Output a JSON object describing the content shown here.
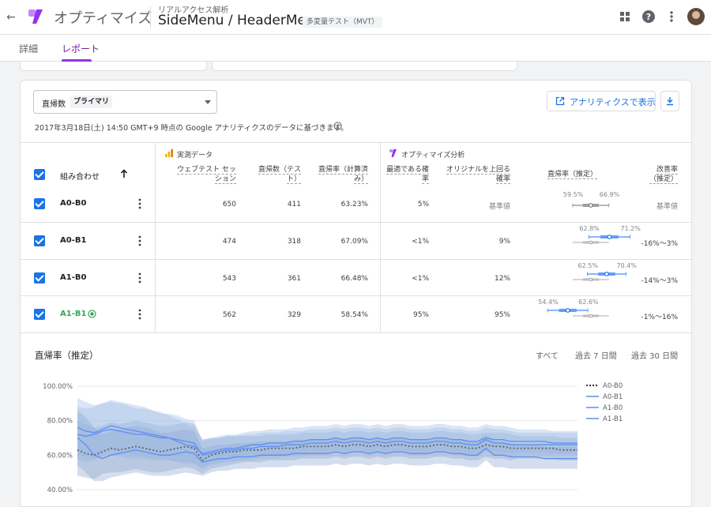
{
  "header": {
    "app_name": "オプティマイズ",
    "container": "リアルアクセス解析",
    "experiment_title": "SideMenu / HeaderMenu",
    "experiment_type": "多変量テスト（MVT）"
  },
  "tabs": [
    {
      "label": "詳細",
      "active": false
    },
    {
      "label": "レポート",
      "active": true
    }
  ],
  "report": {
    "metric_label": "直帰数",
    "metric_value": "プライマリ",
    "analytics_button": "アナリティクスで表示",
    "data_note": "2017年3月18日(土) 14:50 GMT+9 時点の Google アナリティクスのデータに基づきます。"
  },
  "table": {
    "group_observed": "実測データ",
    "group_optimize": "オプティマイズ分析",
    "col_combo": "組み合わせ",
    "col_sessions": "ウェブテスト セッ\nション",
    "col_bounces": "直帰数（テス\nト）",
    "col_rate": "直帰率（計算済\nみ）",
    "col_best": "最適である確\n率",
    "col_beat": "オリジナルを上回る\n確率",
    "col_ci": "直帰率（推定）",
    "col_improve": "改善率\n（推定）",
    "rows": [
      {
        "name": "A0-B0",
        "sessions": "650",
        "bounces": "411",
        "rate": "63.23%",
        "best": "5%",
        "beat": "基準値",
        "ci_low": 59.5,
        "ci_high": 66.9,
        "ci_low_label": "59.5%",
        "ci_high_label": "66.9%",
        "improve": "基準値",
        "winner": false
      },
      {
        "name": "A0-B1",
        "sessions": "474",
        "bounces": "318",
        "rate": "67.09%",
        "best": "<1%",
        "beat": "9%",
        "ci_low": 62.8,
        "ci_high": 71.2,
        "ci_low_label": "62.8%",
        "ci_high_label": "71.2%",
        "improve": "-16%〜3%",
        "winner": false
      },
      {
        "name": "A1-B0",
        "sessions": "543",
        "bounces": "361",
        "rate": "66.48%",
        "best": "<1%",
        "beat": "12%",
        "ci_low": 62.5,
        "ci_high": 70.4,
        "ci_low_label": "62.5%",
        "ci_high_label": "70.4%",
        "improve": "-14%〜3%",
        "winner": false
      },
      {
        "name": "A1-B1",
        "sessions": "562",
        "bounces": "329",
        "rate": "58.54%",
        "best": "95%",
        "beat": "95%",
        "ci_low": 54.4,
        "ci_high": 62.6,
        "ci_low_label": "54.4%",
        "ci_high_label": "62.6%",
        "improve": "-1%〜16%",
        "winner": true
      }
    ]
  },
  "chart_section": {
    "title": "直帰率（推定）",
    "ranges": [
      "すべて",
      "過去 7 日間",
      "過去 30 日間"
    ]
  },
  "colors": {
    "accent_blue": "#1a73e8",
    "series_blue": "#669df6",
    "band_blue": "#a6c0ea",
    "winner_green": "#34a853",
    "optimize_purple": "#9334e6"
  },
  "chart_data": {
    "type": "line",
    "ylim": [
      40,
      100
    ],
    "yticks": [
      "100.00%",
      "80.00%",
      "60.00%",
      "40.00%"
    ],
    "grid": true,
    "legend_position": "right",
    "x": [
      0,
      1,
      2,
      3,
      4,
      5,
      6,
      7,
      8,
      9,
      10,
      11,
      12,
      13,
      14,
      15,
      16,
      17,
      18,
      19,
      20,
      21,
      22,
      23,
      24,
      25,
      26,
      27,
      28,
      29,
      30,
      31,
      32,
      33,
      34,
      35,
      36,
      37,
      38,
      39,
      40,
      41,
      42,
      43,
      44,
      45,
      46,
      47,
      48,
      49,
      50,
      51,
      52,
      53,
      54,
      55,
      56,
      57,
      58,
      59,
      60
    ],
    "series": [
      {
        "name": "A0-B0",
        "style": "dotted",
        "values": [
          63,
          61,
          60,
          62,
          64,
          63,
          64,
          65,
          64,
          63,
          62,
          63,
          64,
          65,
          64,
          57,
          60,
          61,
          62,
          62,
          63,
          63,
          63,
          64,
          64,
          64,
          64,
          65,
          65,
          65,
          65,
          66,
          65,
          66,
          66,
          65,
          66,
          65,
          66,
          66,
          65,
          65,
          65,
          66,
          66,
          65,
          65,
          64,
          64,
          66,
          65,
          65,
          64,
          64,
          64,
          64,
          64,
          64,
          63,
          63,
          63
        ],
        "band_low": [
          48,
          47,
          46,
          49,
          50,
          50,
          51,
          52,
          51,
          50,
          50,
          51,
          52,
          53,
          52,
          49,
          52,
          53,
          54,
          55,
          56,
          56,
          56,
          57,
          57,
          57,
          57,
          58,
          58,
          58,
          58,
          59,
          58,
          59,
          59,
          58,
          59,
          58,
          59,
          59,
          58,
          58,
          58,
          59,
          59,
          58,
          58,
          57,
          57,
          59,
          58,
          58,
          57,
          58,
          58,
          58,
          58,
          58,
          57,
          57,
          57
        ],
        "band_high": [
          80,
          78,
          76,
          77,
          79,
          78,
          79,
          80,
          79,
          78,
          77,
          77,
          78,
          79,
          78,
          69,
          70,
          70,
          71,
          71,
          71,
          71,
          71,
          72,
          72,
          72,
          72,
          73,
          73,
          73,
          73,
          74,
          73,
          74,
          74,
          73,
          74,
          73,
          74,
          74,
          73,
          73,
          73,
          74,
          74,
          73,
          73,
          72,
          72,
          73,
          73,
          73,
          72,
          71,
          71,
          71,
          71,
          71,
          70,
          70,
          70
        ]
      },
      {
        "name": "A0-B1",
        "style": "solid",
        "values": [
          76,
          74,
          73,
          75,
          77,
          76,
          75,
          74,
          73,
          72,
          71,
          70,
          68,
          66,
          65,
          61,
          62,
          63,
          64,
          64,
          65,
          66,
          66,
          67,
          67,
          67,
          68,
          68,
          69,
          69,
          69,
          70,
          69,
          70,
          70,
          69,
          70,
          69,
          70,
          70,
          69,
          69,
          69,
          70,
          70,
          69,
          69,
          68,
          68,
          70,
          69,
          69,
          68,
          68,
          68,
          68,
          68,
          67,
          67,
          67,
          67
        ],
        "band_low": [
          60,
          59,
          58,
          60,
          62,
          61,
          61,
          60,
          59,
          58,
          58,
          57,
          56,
          55,
          55,
          53,
          55,
          56,
          57,
          57,
          58,
          59,
          59,
          60,
          60,
          60,
          61,
          61,
          62,
          62,
          62,
          63,
          62,
          63,
          63,
          62,
          63,
          62,
          63,
          63,
          62,
          62,
          62,
          63,
          63,
          62,
          62,
          61,
          61,
          63,
          62,
          62,
          61,
          62,
          62,
          62,
          62,
          61,
          61,
          61,
          61
        ],
        "band_high": [
          93,
          91,
          89,
          90,
          92,
          91,
          90,
          89,
          88,
          86,
          85,
          83,
          81,
          78,
          76,
          69,
          70,
          71,
          72,
          72,
          73,
          74,
          74,
          75,
          75,
          75,
          76,
          76,
          77,
          77,
          77,
          78,
          77,
          78,
          78,
          77,
          78,
          77,
          78,
          78,
          77,
          77,
          77,
          78,
          78,
          77,
          77,
          76,
          76,
          78,
          77,
          77,
          76,
          75,
          75,
          75,
          75,
          74,
          74,
          74,
          74
        ]
      },
      {
        "name": "A1-B0",
        "style": "solid",
        "values": [
          72,
          71,
          72,
          74,
          75,
          74,
          73,
          72,
          72,
          71,
          70,
          70,
          69,
          68,
          67,
          60,
          61,
          62,
          63,
          63,
          64,
          64,
          65,
          65,
          65,
          66,
          66,
          66,
          67,
          67,
          67,
          68,
          67,
          68,
          68,
          67,
          68,
          67,
          68,
          68,
          67,
          67,
          67,
          68,
          68,
          67,
          67,
          66,
          66,
          69,
          67,
          67,
          66,
          66,
          66,
          66,
          66,
          66,
          66,
          66,
          66
        ],
        "band_low": [
          57,
          56,
          57,
          59,
          60,
          59,
          58,
          58,
          58,
          57,
          57,
          57,
          56,
          56,
          55,
          52,
          54,
          55,
          56,
          56,
          57,
          57,
          58,
          58,
          58,
          59,
          59,
          59,
          60,
          60,
          60,
          61,
          60,
          61,
          61,
          60,
          61,
          60,
          61,
          61,
          60,
          60,
          60,
          61,
          61,
          60,
          60,
          59,
          59,
          62,
          60,
          60,
          59,
          60,
          60,
          60,
          60,
          60,
          60,
          60,
          60
        ],
        "band_high": [
          88,
          87,
          88,
          90,
          91,
          90,
          89,
          87,
          87,
          86,
          84,
          84,
          83,
          81,
          80,
          68,
          69,
          70,
          71,
          71,
          72,
          72,
          73,
          73,
          73,
          74,
          74,
          74,
          75,
          75,
          75,
          76,
          75,
          76,
          76,
          75,
          76,
          75,
          76,
          76,
          75,
          75,
          75,
          76,
          76,
          75,
          75,
          74,
          74,
          76,
          75,
          75,
          74,
          73,
          73,
          73,
          73,
          73,
          73,
          73,
          73
        ]
      },
      {
        "name": "A1-B1",
        "style": "solid",
        "values": [
          70,
          66,
          60,
          58,
          60,
          61,
          62,
          63,
          62,
          61,
          60,
          60,
          61,
          62,
          61,
          56,
          57,
          58,
          58,
          59,
          59,
          59,
          60,
          60,
          60,
          60,
          61,
          61,
          61,
          61,
          61,
          62,
          61,
          62,
          62,
          61,
          62,
          61,
          62,
          62,
          61,
          61,
          61,
          62,
          62,
          61,
          61,
          60,
          60,
          64,
          60,
          60,
          59,
          59,
          59,
          59,
          58,
          58,
          58,
          58,
          58
        ],
        "band_low": [
          54,
          50,
          45,
          45,
          47,
          48,
          49,
          50,
          49,
          48,
          48,
          48,
          49,
          50,
          49,
          48,
          50,
          51,
          51,
          52,
          52,
          52,
          53,
          53,
          53,
          53,
          54,
          54,
          54,
          54,
          54,
          55,
          54,
          55,
          55,
          54,
          55,
          54,
          55,
          55,
          54,
          54,
          54,
          55,
          55,
          54,
          54,
          53,
          53,
          57,
          53,
          53,
          52,
          52,
          52,
          52,
          52,
          52,
          52,
          52,
          52
        ],
        "band_high": [
          86,
          82,
          76,
          72,
          74,
          75,
          76,
          77,
          76,
          75,
          73,
          73,
          74,
          75,
          74,
          64,
          65,
          66,
          66,
          67,
          67,
          67,
          68,
          68,
          68,
          68,
          69,
          69,
          69,
          69,
          69,
          70,
          69,
          70,
          70,
          69,
          70,
          69,
          70,
          70,
          69,
          69,
          69,
          70,
          70,
          69,
          69,
          68,
          68,
          72,
          68,
          68,
          67,
          66,
          66,
          66,
          65,
          65,
          65,
          65,
          65
        ]
      }
    ]
  }
}
